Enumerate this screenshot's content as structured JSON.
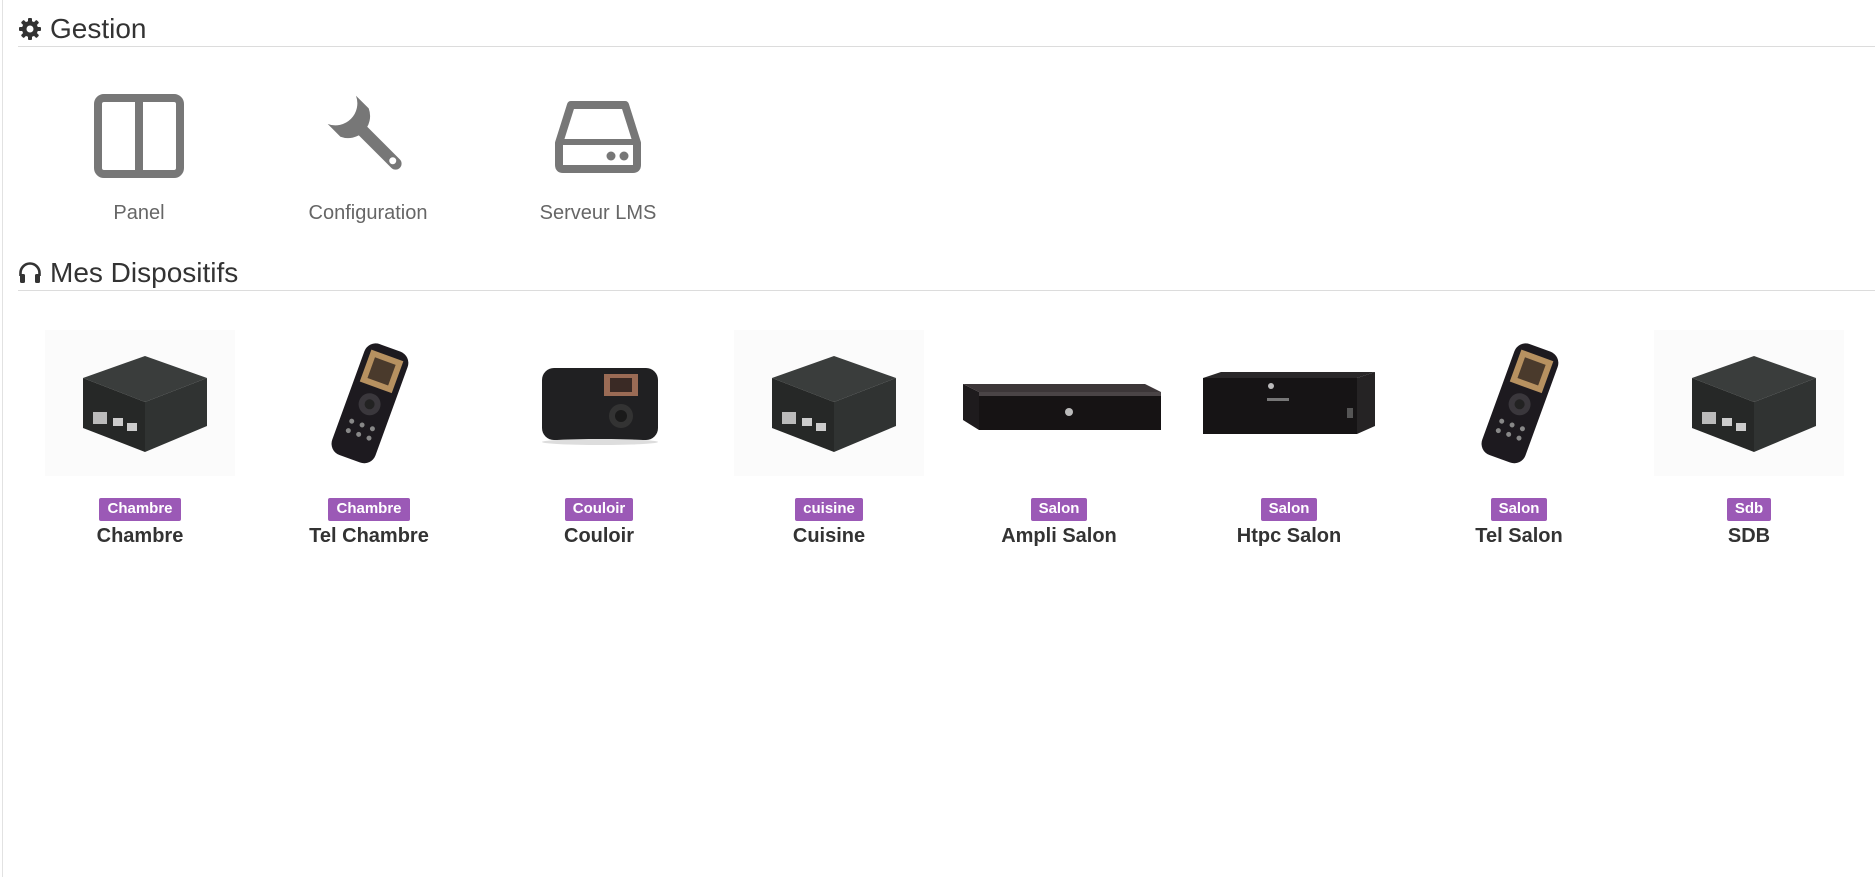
{
  "gestion": {
    "title": "Gestion",
    "icon": "gear-icon",
    "items": [
      {
        "label": "Panel",
        "icon": "panel-columns-icon"
      },
      {
        "label": "Configuration",
        "icon": "wrench-icon"
      },
      {
        "label": "Serveur LMS",
        "icon": "hdd-drive-icon"
      }
    ]
  },
  "dispositifs": {
    "title": "Mes Dispositifs",
    "icon": "headphones-icon",
    "badge_color": "#9b59b6",
    "devices": [
      {
        "name": "Chambre",
        "room": "Chambre",
        "image": "raspberry-pi-case"
      },
      {
        "name": "Tel Chambre",
        "room": "Chambre",
        "image": "squeezebox-remote"
      },
      {
        "name": "Couloir",
        "room": "Couloir",
        "image": "squeezebox-radio"
      },
      {
        "name": "Cuisine",
        "room": "cuisine",
        "image": "raspberry-pi-case"
      },
      {
        "name": "Ampli Salon",
        "room": "Salon",
        "image": "amplifier-box"
      },
      {
        "name": "Htpc Salon",
        "room": "Salon",
        "image": "htpc-case"
      },
      {
        "name": "Tel Salon",
        "room": "Salon",
        "image": "squeezebox-remote"
      },
      {
        "name": "SDB",
        "room": "Sdb",
        "image": "raspberry-pi-case"
      }
    ]
  }
}
